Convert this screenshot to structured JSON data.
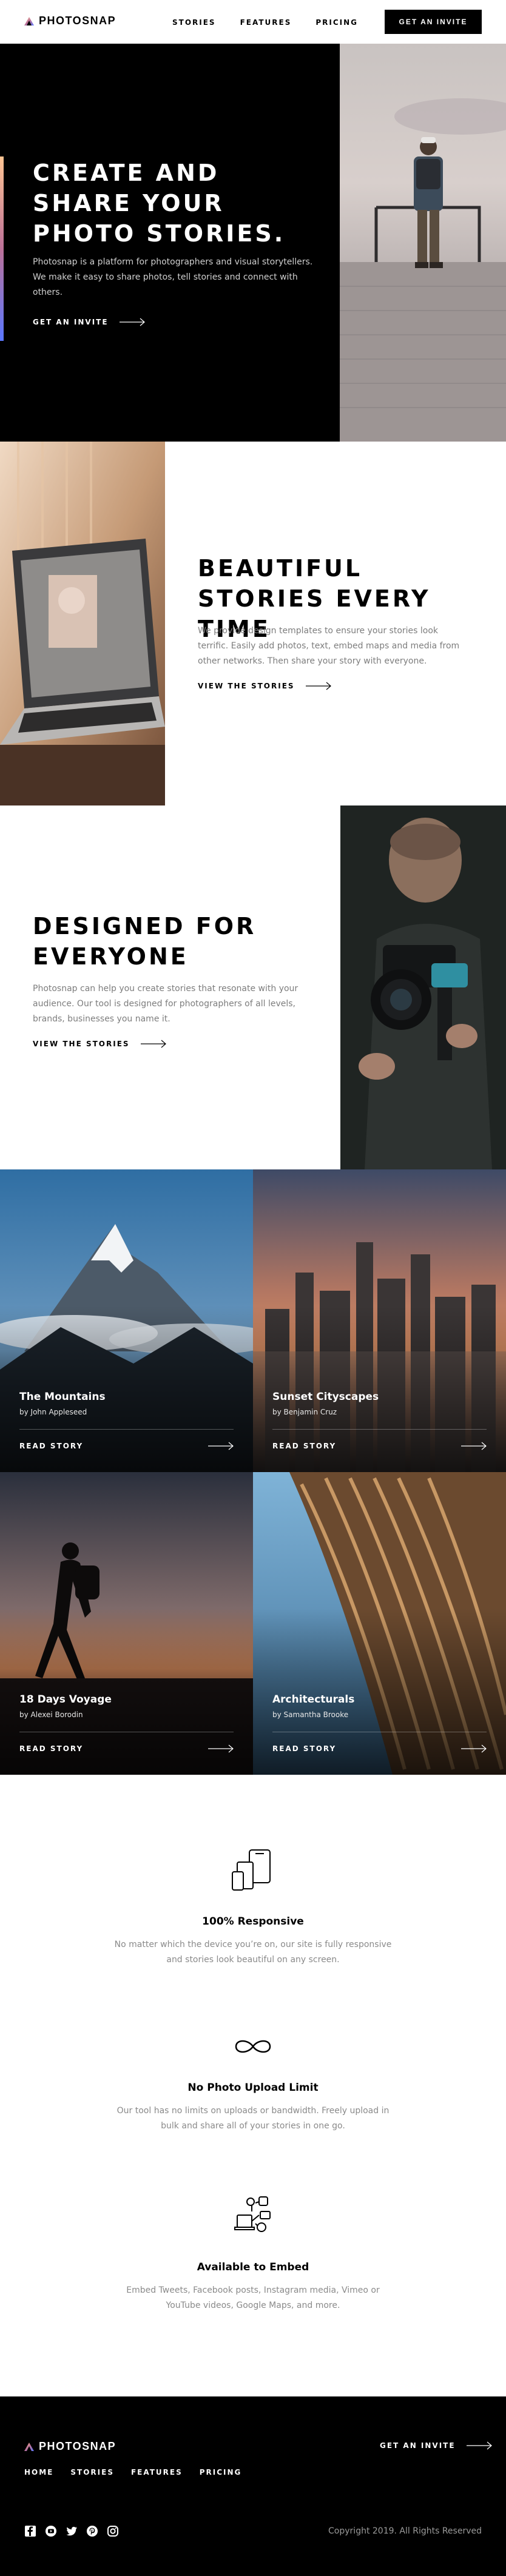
{
  "brand": {
    "name": "PHOTOSNAP"
  },
  "nav": {
    "items": [
      "STORIES",
      "FEATURES",
      "PRICING"
    ],
    "invite_label": "GET AN INVITE"
  },
  "hero": {
    "title": "CREATE AND SHARE YOUR PHOTO STORIES.",
    "body": "Photosnap is a platform for photographers and visual storytellers. We make it easy to share photos, tell stories and connect with others.",
    "cta": "GET AN INVITE",
    "accent_colors": [
      "#ffc593",
      "#bc7198",
      "#5a77ff"
    ]
  },
  "sections": [
    {
      "title": "BEAUTIFUL STORIES EVERY TIME",
      "body": "We provide design templates to ensure your stories look terrific. Easily add photos, text, embed maps and media from other networks. Then share your story with everyone.",
      "cta": "VIEW THE STORIES"
    },
    {
      "title": "DESIGNED FOR EVERYONE",
      "body": "Photosnap can help you create stories that resonate with your audience. Our tool is designed for photographers of all levels, brands, businesses you name it.",
      "cta": "VIEW THE STORIES"
    }
  ],
  "stories": [
    {
      "title": "The Mountains",
      "author": "by John Appleseed",
      "cta": "READ STORY"
    },
    {
      "title": "Sunset Cityscapes",
      "author": "by Benjamin Cruz",
      "cta": "READ STORY"
    },
    {
      "title": "18 Days Voyage",
      "author": "by Alexei Borodin",
      "cta": "READ STORY"
    },
    {
      "title": "Architecturals",
      "author": "by Samantha Brooke",
      "cta": "READ STORY"
    }
  ],
  "features": [
    {
      "icon": "responsive-devices-icon",
      "title": "100% Responsive",
      "body": "No matter which the device you’re on, our site is fully responsive and stories look beautiful on any screen."
    },
    {
      "icon": "infinity-icon",
      "title": "No Photo Upload Limit",
      "body": "Our tool has no limits on uploads or bandwidth. Freely upload in bulk and share all of your stories in one go."
    },
    {
      "icon": "embed-media-icon",
      "title": "Available to Embed",
      "body": "Embed Tweets, Facebook posts, Instagram media, Vimeo or YouTube videos, Google Maps, and more."
    }
  ],
  "footer": {
    "nav": [
      "HOME",
      "STORIES",
      "FEATURES",
      "PRICING"
    ],
    "cta": "GET AN INVITE",
    "copyright": "Copyright 2019. All Rights Reserved",
    "social": [
      "facebook-icon",
      "youtube-icon",
      "twitter-icon",
      "pinterest-icon",
      "instagram-icon"
    ]
  }
}
